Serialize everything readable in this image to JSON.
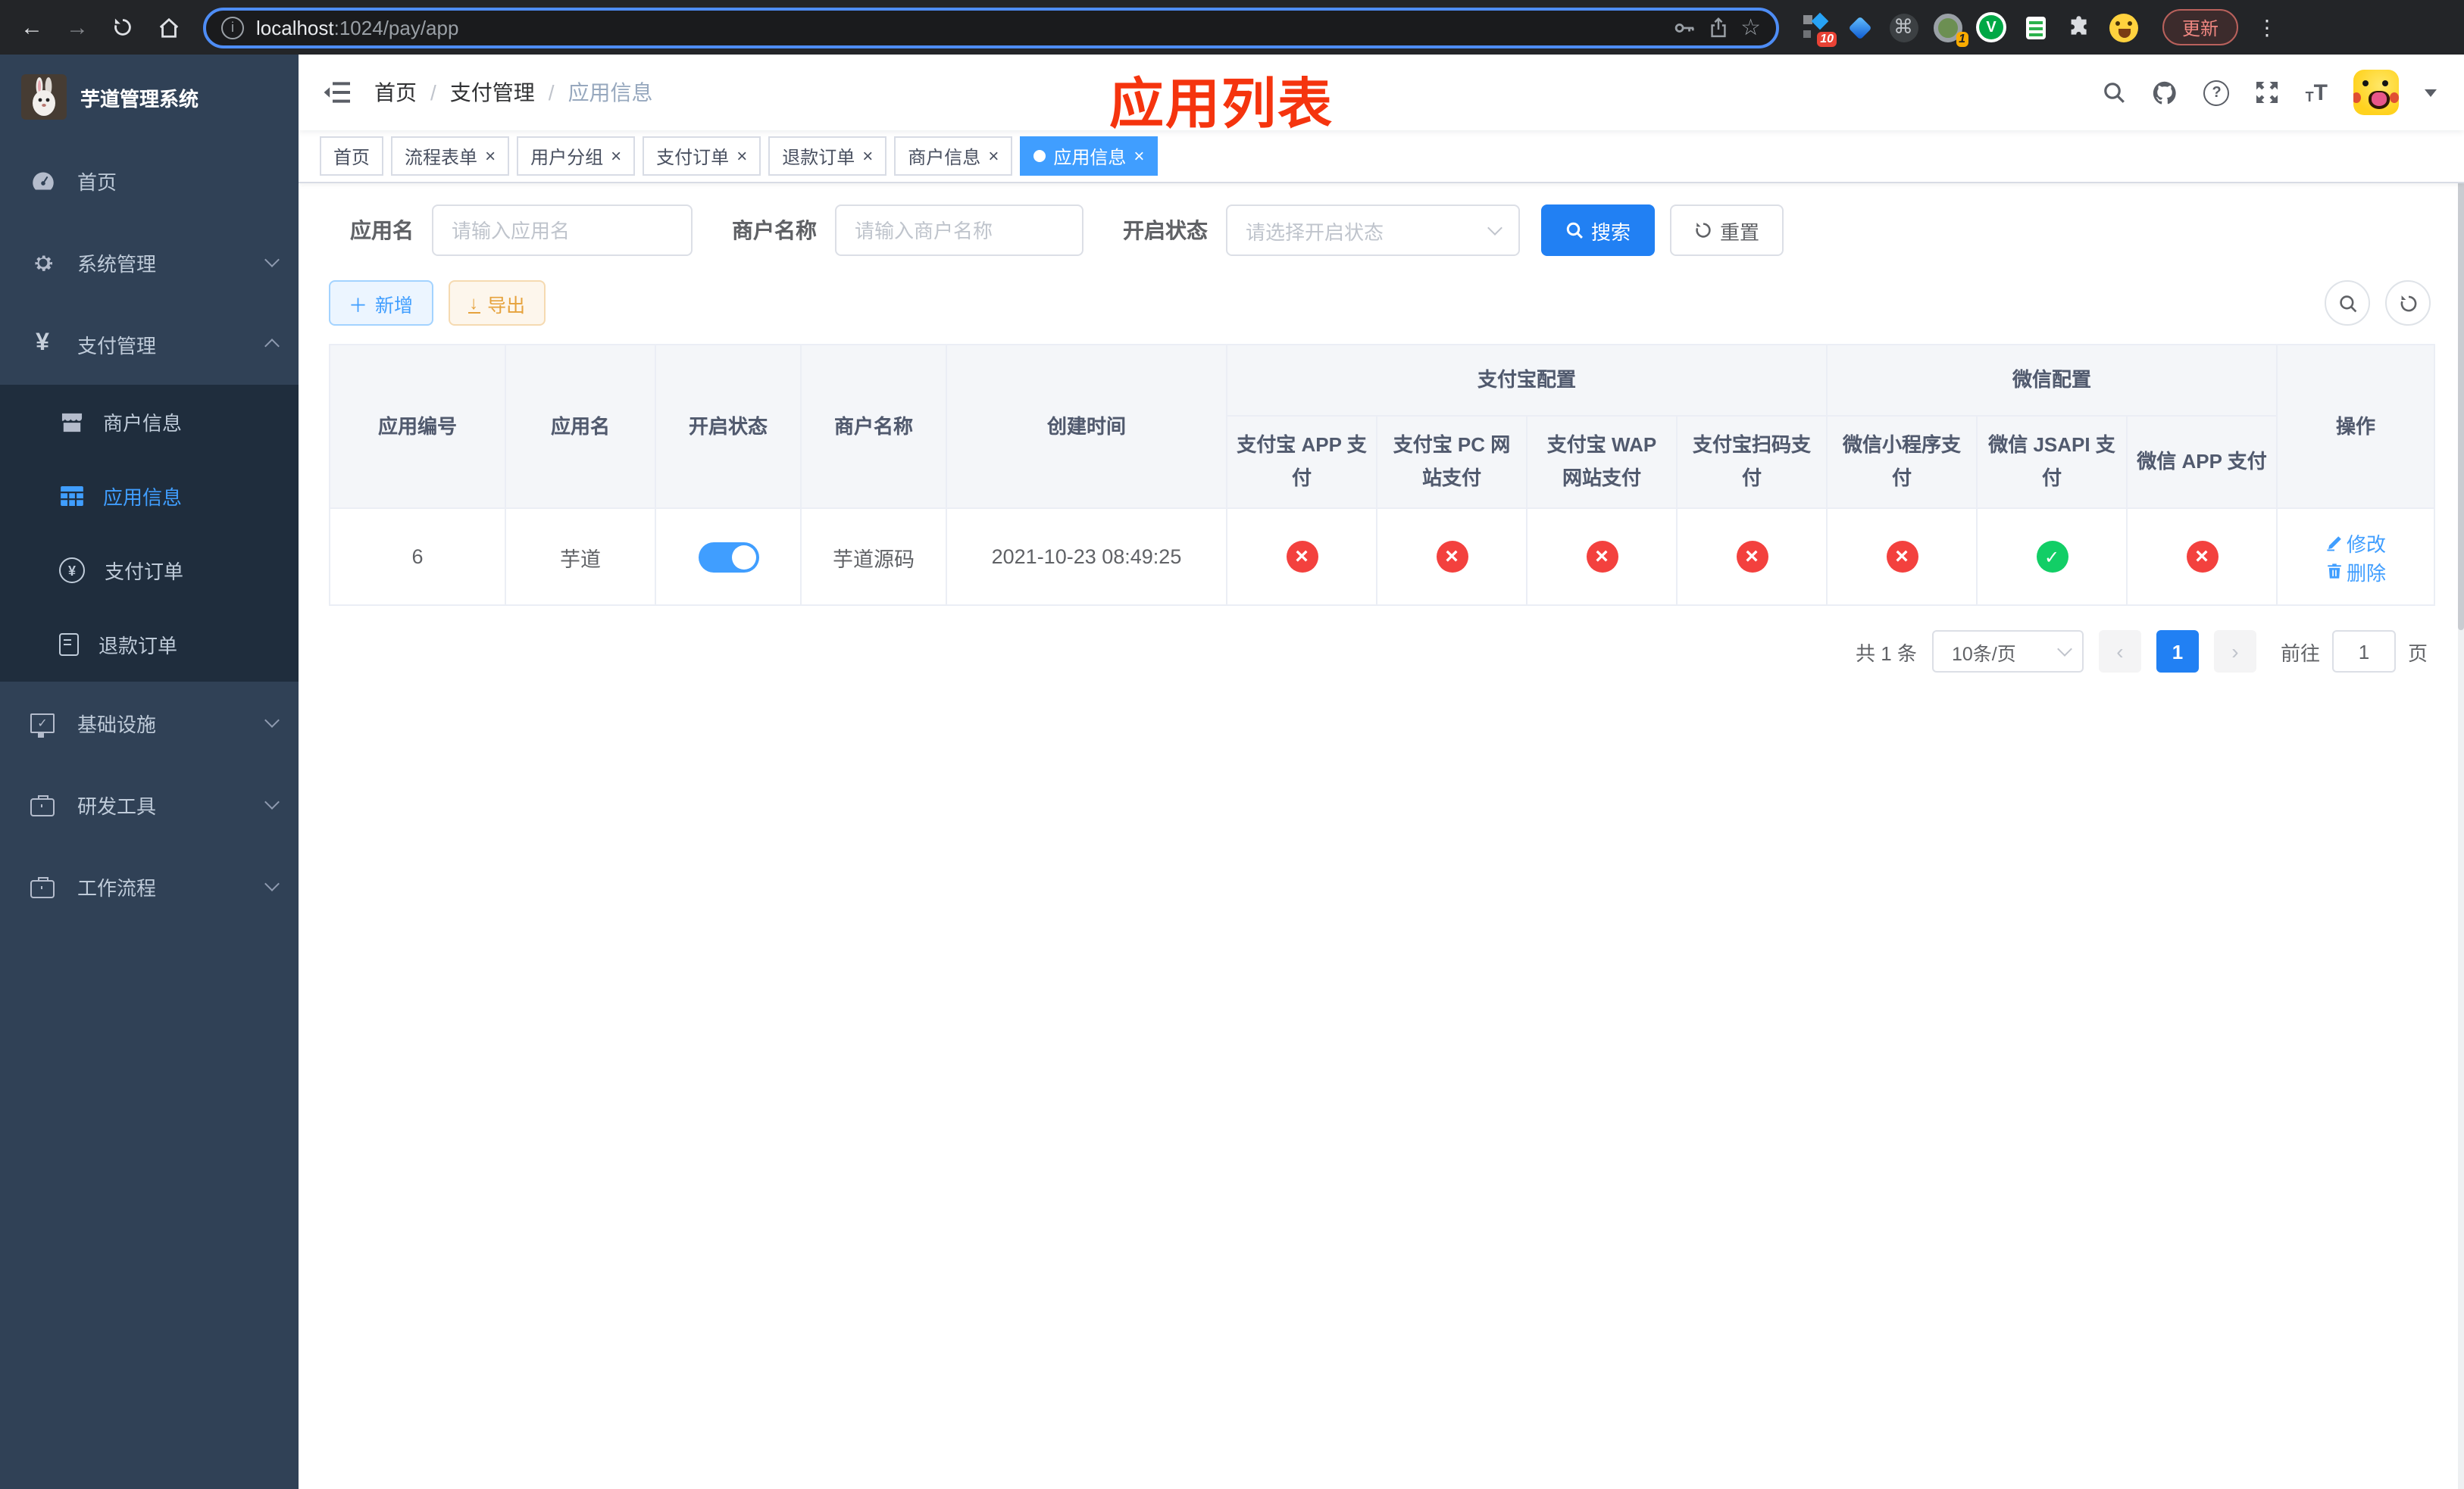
{
  "colors": {
    "accent_blue": "#409eff",
    "primary_button_blue": "#2180f3",
    "danger_red": "#f3413e",
    "success_green": "#12ce66",
    "warning_orange": "#e6a23c",
    "title_red": "#f5340e",
    "sidebar_bg": "#304156",
    "sidebar_submenu_bg": "#1f2d3d",
    "chrome_update_red": "#ee8680"
  },
  "browser": {
    "url_host": "localhost",
    "url_rest": ":1024/pay/app",
    "update_label": "更新",
    "ext_badge_a": "10",
    "ext_badge_b": "1"
  },
  "sidebar": {
    "title": "芋道管理系统",
    "items": [
      "首页",
      "系统管理",
      "支付管理",
      "基础设施",
      "研发工具",
      "工作流程"
    ],
    "submenu": [
      "商户信息",
      "应用信息",
      "支付订单",
      "退款订单"
    ]
  },
  "navbar": {
    "breadcrumb": [
      "首页",
      "支付管理",
      "应用信息"
    ]
  },
  "overlay_title": "应用列表",
  "tabs": [
    "首页",
    "流程表单",
    "用户分组",
    "支付订单",
    "退款订单",
    "商户信息",
    "应用信息"
  ],
  "filters": {
    "app_name_label": "应用名",
    "app_name_placeholder": "请输入应用名",
    "merchant_label": "商户名称",
    "merchant_placeholder": "请输入商户名称",
    "status_label": "开启状态",
    "status_placeholder": "请选择开启状态",
    "search_label": "搜索",
    "reset_label": "重置"
  },
  "toolbar": {
    "add_label": "新增",
    "export_label": "导出"
  },
  "table": {
    "group_alipay": "支付宝配置",
    "group_wechat": "微信配置",
    "col_id": "应用编号",
    "col_name": "应用名",
    "col_status": "开启状态",
    "col_merchant": "商户名称",
    "col_created": "创建时间",
    "col_alipay_app": "支付宝 APP 支付",
    "col_alipay_pc": "支付宝 PC 网站支付",
    "col_alipay_wap": "支付宝 WAP 网站支付",
    "col_alipay_qr": "支付宝扫码支付",
    "col_wx_lite": "微信小程序支付",
    "col_wx_jsapi": "微信 JSAPI 支付",
    "col_wx_app": "微信 APP 支付",
    "col_actions": "操作",
    "row": {
      "id": "6",
      "name": "芋道",
      "enabled": true,
      "merchant": "芋道源码",
      "created_at": "2021-10-23 08:49:25",
      "alipay_app": false,
      "alipay_pc": false,
      "alipay_wap": false,
      "alipay_qr": false,
      "wx_lite": false,
      "wx_jsapi": true,
      "wx_app": false,
      "edit_label": "修改",
      "delete_label": "删除"
    }
  },
  "pagination": {
    "total": "共 1 条",
    "per_page": "10条/页",
    "current_page": "1",
    "goto_label": "前往",
    "goto_value": "1",
    "unit_label": "页"
  },
  "icons": {
    "back": "arrow-left",
    "forward": "arrow-right",
    "reload": "reload",
    "home": "home",
    "info": "info-circle",
    "key": "key",
    "share": "share-up",
    "star": "star-outline",
    "fold": "menu-fold",
    "search": "magnifier",
    "github": "octocat",
    "help": "question-circle",
    "fullscreen": "expand-arrows",
    "font_size": "text-size",
    "caret": "caret-down",
    "add": "plus",
    "export": "download",
    "reset": "refresh",
    "edit": "pencil",
    "delete": "trash",
    "close": "x",
    "active_dot": "dot"
  }
}
